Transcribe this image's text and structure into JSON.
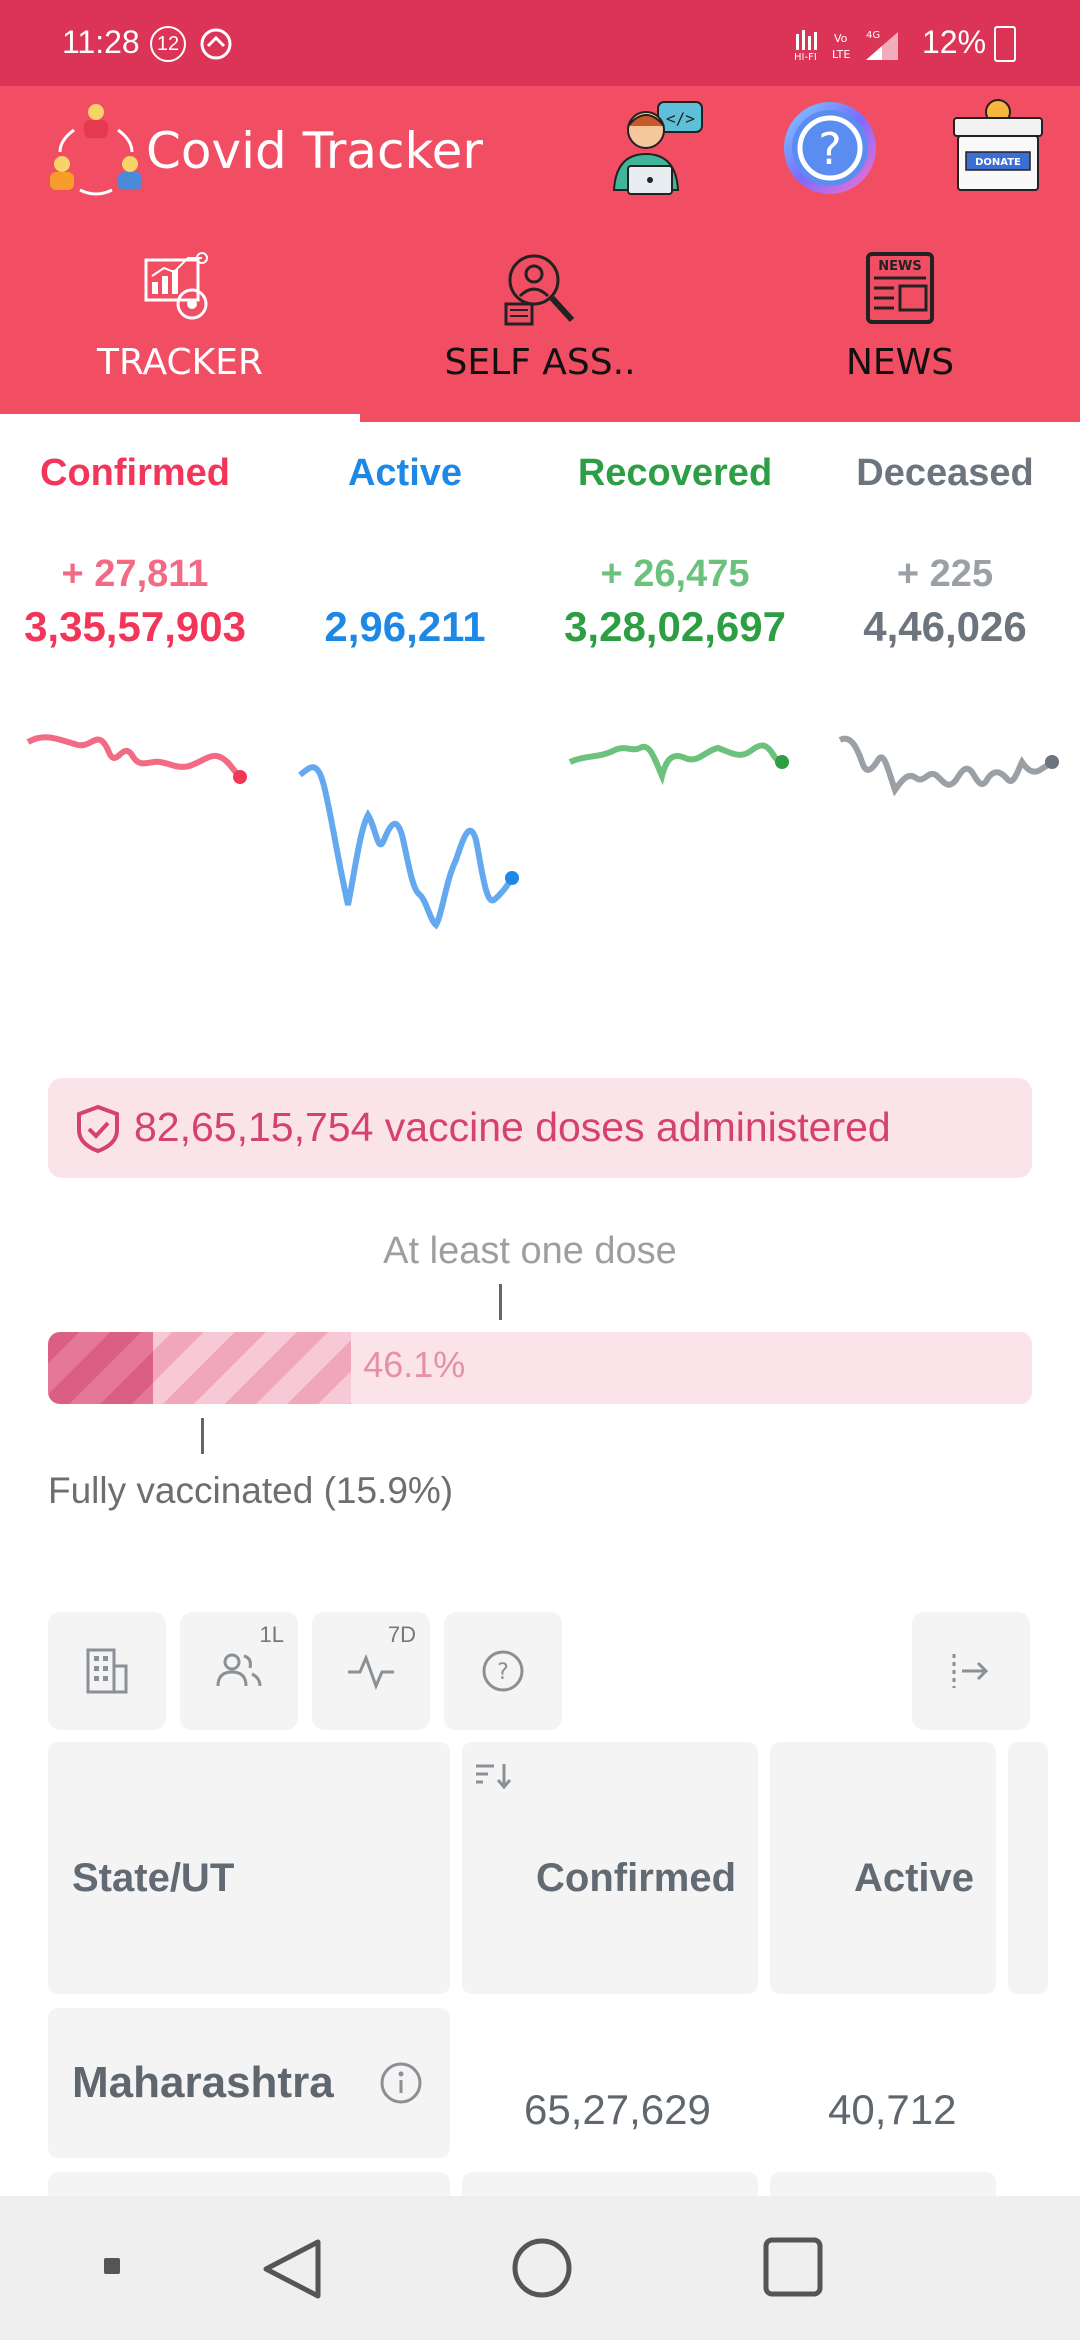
{
  "status_bar": {
    "time": "11:28",
    "notification_count": "12",
    "network": "HI-FI Vo LTE 4G",
    "battery": "12%"
  },
  "header": {
    "app_title": "Covid Tracker",
    "donate_label": "DONATE",
    "help_glyph": "?",
    "icons": [
      "team-cycle-icon",
      "developer-icon",
      "help-icon",
      "donate-box-icon"
    ]
  },
  "tabs": [
    {
      "label": "TRACKER",
      "icon": "analytics-icon",
      "selected": true
    },
    {
      "label": "SELF ASS..",
      "icon": "self-assessment-icon",
      "selected": false
    },
    {
      "label": "NEWS",
      "icon": "newspaper-icon",
      "selected": false
    }
  ],
  "stats": [
    {
      "label": "Confirmed",
      "delta": "+ 27,811",
      "total": "3,35,57,903",
      "color": "#f2365a",
      "delta_color": "#f26a84"
    },
    {
      "label": "Active",
      "delta": "",
      "total": "2,96,211",
      "color": "#1e88e5",
      "delta_color": "#1e88e5"
    },
    {
      "label": "Recovered",
      "delta": "+ 26,475",
      "total": "3,28,02,697",
      "color": "#2e9e44",
      "delta_color": "#6cc17d"
    },
    {
      "label": "Deceased",
      "delta": "+ 225",
      "total": "4,46,026",
      "color": "#6c757d",
      "delta_color": "#9aa0a6"
    }
  ],
  "vaccination": {
    "banner": "82,65,15,754 vaccine doses administered",
    "at_least_one_dose_label": "At least one dose",
    "at_least_one_dose_pct": 46.1,
    "at_least_one_dose_text": "46.1%",
    "fully_vaccinated_pct": 15.9,
    "fully_vaccinated_label": "Fully vaccinated (15.9%)"
  },
  "table_toolbar": {
    "buttons": [
      {
        "icon": "building-icon",
        "sup": ""
      },
      {
        "icon": "people-icon",
        "sup": "1L"
      },
      {
        "icon": "pulse-icon",
        "sup": "7D"
      },
      {
        "icon": "help-circle-icon",
        "sup": ""
      }
    ],
    "expand_icon": "expand-icon"
  },
  "table": {
    "headers": [
      "State/UT",
      "Confirmed",
      "Active"
    ],
    "rows": [
      {
        "state": "Maharashtra",
        "confirmed": "65,27,629",
        "active": "40,712"
      }
    ]
  },
  "nav_bar": [
    "menu-square-icon",
    "back-icon",
    "home-icon",
    "recents-icon"
  ]
}
